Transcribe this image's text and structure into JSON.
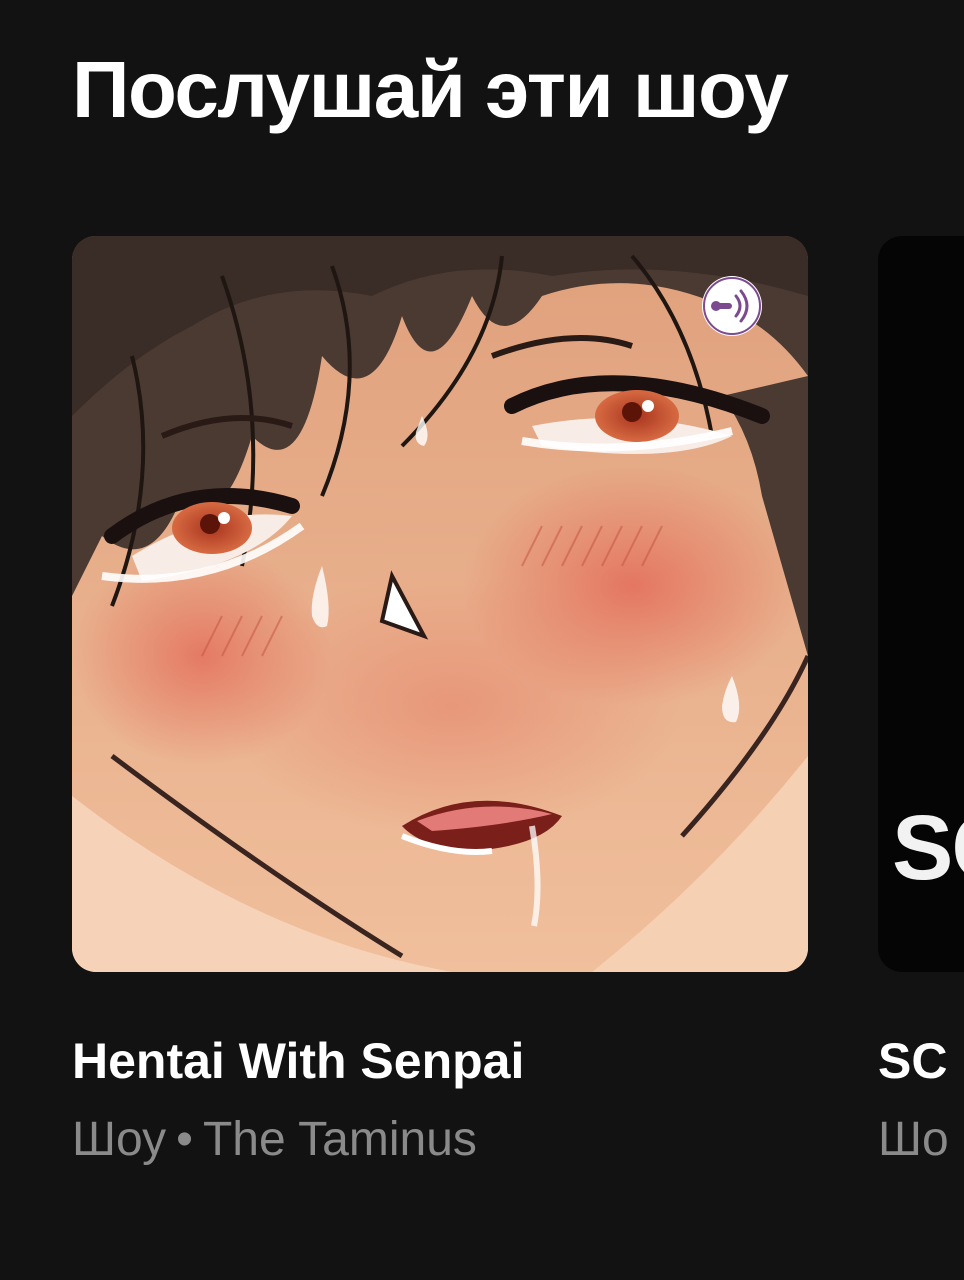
{
  "section": {
    "title": "Послушай эти шоу"
  },
  "cards": [
    {
      "title": "Hentai With Senpai",
      "type_label": "Шоу",
      "separator": "•",
      "publisher": "The Taminus",
      "cover_icon": "anchor-podcast-badge-icon",
      "cover_description": "anime illustration"
    },
    {
      "title": "SC",
      "type_label": "Шо",
      "cover_text": "SC"
    }
  ],
  "colors": {
    "background": "#121212",
    "title_text": "#ffffff",
    "secondary_text": "#8a8a8a",
    "second_cover": "#050505"
  }
}
